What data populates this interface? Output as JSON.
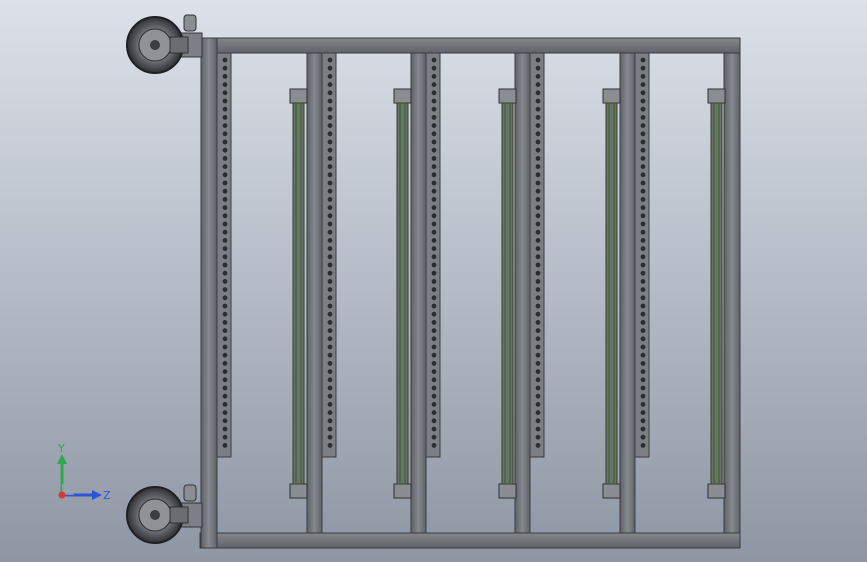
{
  "viewport": {
    "background_top": "#dde1e8",
    "background_bottom": "#8e96a3",
    "frame_color": "#6f7277",
    "frame_edge": "#3a3c40",
    "rail_color": "#4d5a3f",
    "hole_color": "#2b2d31"
  },
  "triad": {
    "x_label": "Z",
    "y_label": "Y",
    "y_color": "#2fa84f",
    "z_color": "#2b56d8",
    "origin_color": "#d23a3a"
  },
  "model": {
    "name_icon": "rack-cart-model",
    "columns_with_holes": 5,
    "shelf_rails": 5,
    "casters": 2
  }
}
